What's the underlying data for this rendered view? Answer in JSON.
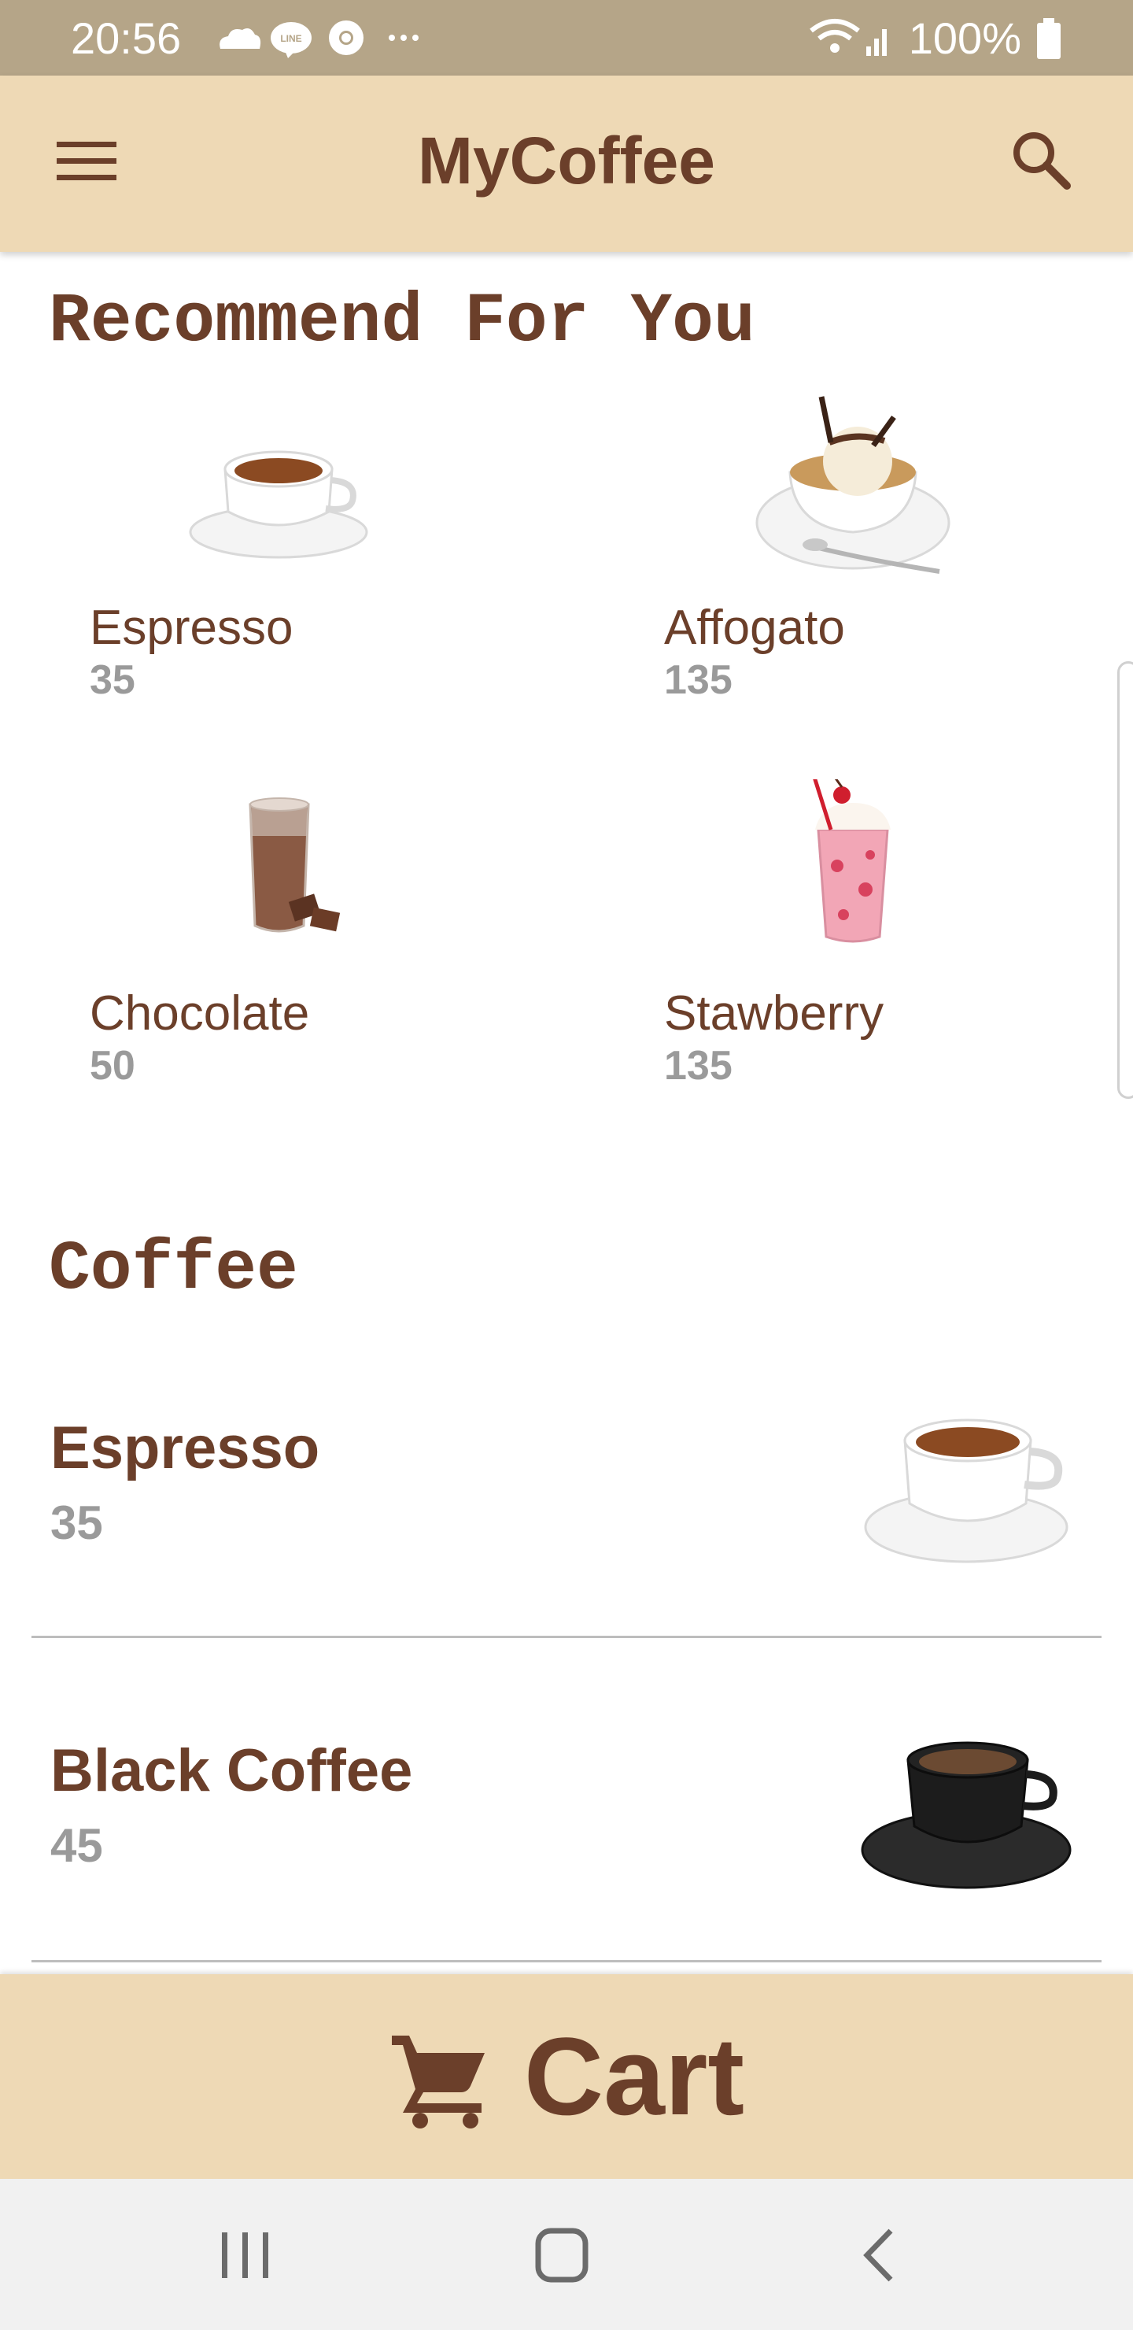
{
  "status_bar": {
    "time": "20:56",
    "battery": "100%",
    "icons": [
      "cloud-icon",
      "line-icon",
      "chrome-icon",
      "more-icon",
      "wifi-icon",
      "signal-icon",
      "battery-icon"
    ]
  },
  "app_bar": {
    "title": "MyCoffee",
    "menu_icon": "menu-icon",
    "search_icon": "search-icon"
  },
  "recommend": {
    "heading": "Recommend For You",
    "items": [
      {
        "name": "Espresso",
        "price": "35",
        "image": "espresso-cup"
      },
      {
        "name": "Affogato",
        "price": "135",
        "image": "affogato-bowl"
      },
      {
        "name": "Chocolate",
        "price": "50",
        "image": "iced-chocolate-glass"
      },
      {
        "name": "Stawberry",
        "price": "135",
        "image": "strawberry-milkshake"
      }
    ]
  },
  "coffee": {
    "heading": "Coffee",
    "items": [
      {
        "name": "Espresso",
        "price": "35",
        "image": "espresso-cup"
      },
      {
        "name": "Black Coffee",
        "price": "45",
        "image": "black-coffee-cup"
      }
    ]
  },
  "cart": {
    "label": "Cart",
    "icon": "cart-icon"
  },
  "colors": {
    "status_bar": "#b5a588",
    "app_bar": "#eed9b5",
    "brand_brown": "#6b3f2a",
    "price_gray": "#9a9a9a",
    "nav_bar": "#f1f1f1"
  }
}
